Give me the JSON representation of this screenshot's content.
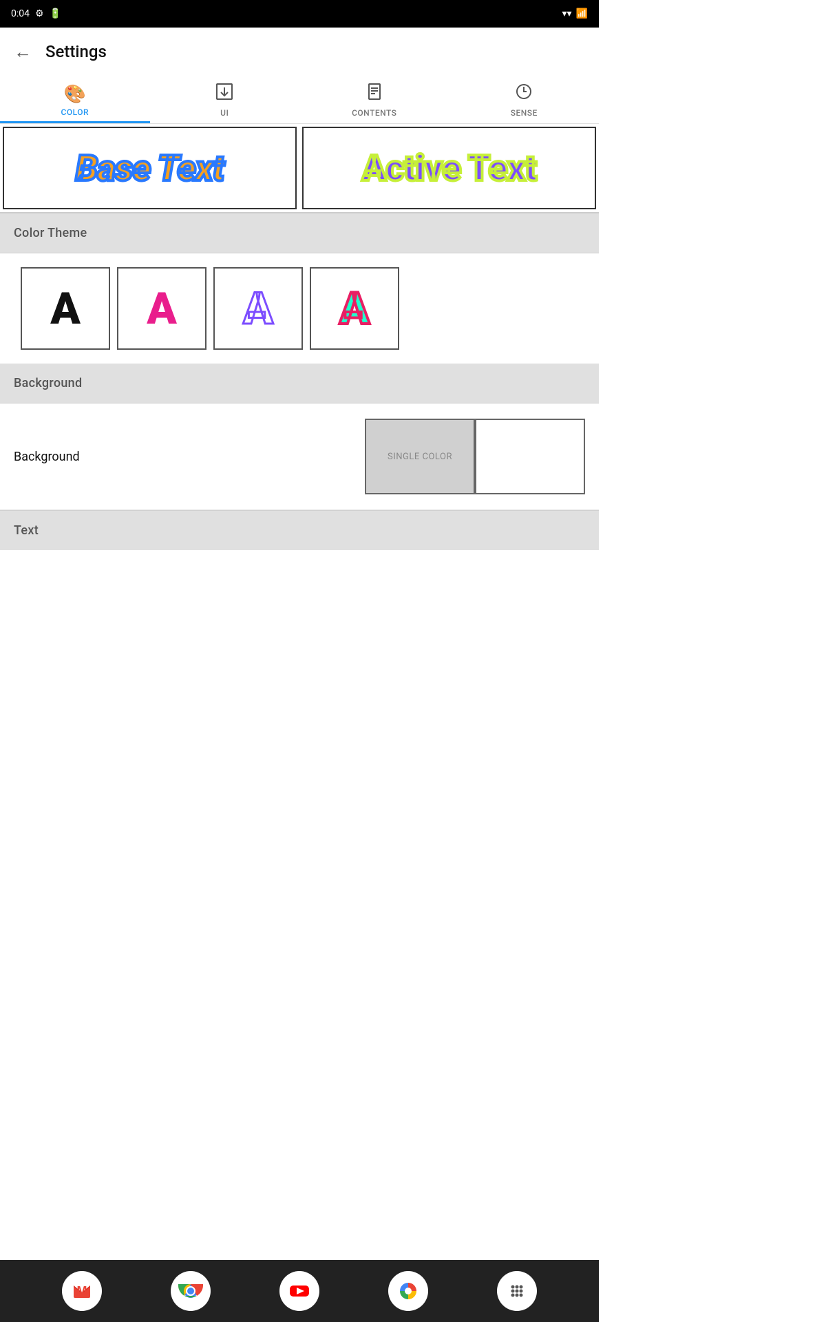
{
  "statusBar": {
    "time": "0:04",
    "icons": [
      "settings",
      "battery"
    ]
  },
  "header": {
    "back_label": "←",
    "title": "Settings"
  },
  "tabs": [
    {
      "id": "color",
      "label": "COLOR",
      "icon": "🎨",
      "active": true
    },
    {
      "id": "ui",
      "label": "UI",
      "icon": "⬇",
      "active": false
    },
    {
      "id": "contents",
      "label": "CONTENTS",
      "icon": "📄",
      "active": false
    },
    {
      "id": "sense",
      "label": "SENSE",
      "icon": "⏱",
      "active": false
    }
  ],
  "textPreview": {
    "baseText": "Base Text",
    "activeText": "Active Text"
  },
  "colorTheme": {
    "sectionLabel": "Color Theme",
    "options": [
      {
        "id": "plain",
        "label": "A"
      },
      {
        "id": "pink",
        "label": "A"
      },
      {
        "id": "outline",
        "label": "A"
      },
      {
        "id": "multi",
        "label": "A"
      }
    ]
  },
  "background": {
    "sectionLabel": "Background",
    "rowLabel": "Background",
    "options": [
      {
        "id": "single-color",
        "label": "SINGLE COLOR"
      },
      {
        "id": "white",
        "label": ""
      }
    ]
  },
  "text": {
    "sectionLabel": "Text"
  },
  "bottomNav": {
    "items": [
      {
        "id": "gmail",
        "label": "Gmail"
      },
      {
        "id": "chrome",
        "label": "Chrome"
      },
      {
        "id": "youtube",
        "label": "YouTube"
      },
      {
        "id": "photos",
        "label": "Photos"
      },
      {
        "id": "apps",
        "label": "Apps"
      }
    ]
  }
}
